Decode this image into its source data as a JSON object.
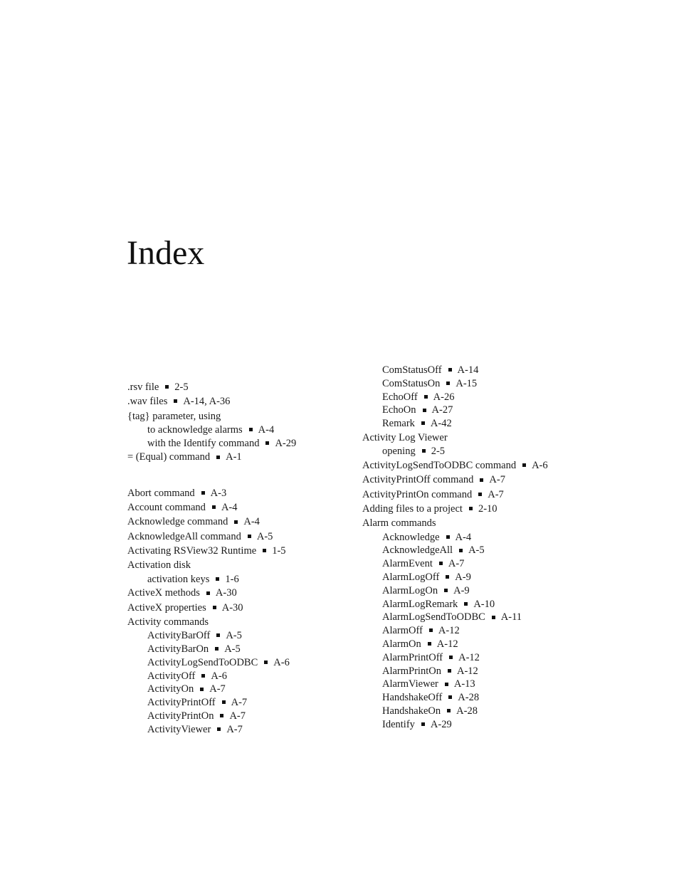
{
  "title": "Index",
  "left_column": [
    {
      "level": 0,
      "term": ".rsv file",
      "pages": "2-5"
    },
    {
      "level": 0,
      "term": ".wav files",
      "pages": "A-14, A-36"
    },
    {
      "level": 0,
      "term": "{tag} parameter, using",
      "pages": ""
    },
    {
      "level": 1,
      "term": "to acknowledge alarms",
      "pages": "A-4"
    },
    {
      "level": 1,
      "term": "with the Identify command",
      "pages": "A-29"
    },
    {
      "level": 0,
      "term": "= (Equal) command",
      "pages": "A-1"
    },
    {
      "level": "gap"
    },
    {
      "level": 0,
      "term": "Abort command",
      "pages": "A-3"
    },
    {
      "level": 0,
      "term": "Account command",
      "pages": "A-4"
    },
    {
      "level": 0,
      "term": "Acknowledge command",
      "pages": "A-4"
    },
    {
      "level": 0,
      "term": "AcknowledgeAll command",
      "pages": "A-5"
    },
    {
      "level": 0,
      "term": "Activating RSView32 Runtime",
      "pages": "1-5"
    },
    {
      "level": 0,
      "term": "Activation disk",
      "pages": ""
    },
    {
      "level": 1,
      "term": "activation keys",
      "pages": "1-6"
    },
    {
      "level": 0,
      "term": "ActiveX methods",
      "pages": "A-30"
    },
    {
      "level": 0,
      "term": "ActiveX properties",
      "pages": "A-30"
    },
    {
      "level": 0,
      "term": "Activity commands",
      "pages": ""
    },
    {
      "level": 1,
      "term": "ActivityBarOff",
      "pages": "A-5"
    },
    {
      "level": 1,
      "term": "ActivityBarOn",
      "pages": "A-5"
    },
    {
      "level": 1,
      "term": "ActivityLogSendToODBC",
      "pages": "A-6"
    },
    {
      "level": 1,
      "term": "ActivityOff",
      "pages": "A-6"
    },
    {
      "level": 1,
      "term": "ActivityOn",
      "pages": "A-7"
    },
    {
      "level": 1,
      "term": "ActivityPrintOff",
      "pages": "A-7"
    },
    {
      "level": 1,
      "term": "ActivityPrintOn",
      "pages": "A-7"
    },
    {
      "level": 1,
      "term": "ActivityViewer",
      "pages": "A-7"
    }
  ],
  "right_column": [
    {
      "level": 1,
      "term": "ComStatusOff",
      "pages": "A-14"
    },
    {
      "level": 1,
      "term": "ComStatusOn",
      "pages": "A-15"
    },
    {
      "level": 1,
      "term": "EchoOff",
      "pages": "A-26"
    },
    {
      "level": 1,
      "term": "EchoOn",
      "pages": "A-27"
    },
    {
      "level": 1,
      "term": "Remark",
      "pages": "A-42"
    },
    {
      "level": 0,
      "term": "Activity Log Viewer",
      "pages": ""
    },
    {
      "level": 1,
      "term": "opening",
      "pages": "2-5"
    },
    {
      "level": 0,
      "term": "ActivityLogSendToODBC command",
      "pages": "A-6"
    },
    {
      "level": 0,
      "term": "ActivityPrintOff command",
      "pages": "A-7"
    },
    {
      "level": 0,
      "term": "ActivityPrintOn command",
      "pages": "A-7"
    },
    {
      "level": 0,
      "term": "Adding files to a project",
      "pages": "2-10"
    },
    {
      "level": 0,
      "term": "Alarm commands",
      "pages": ""
    },
    {
      "level": 1,
      "term": "Acknowledge",
      "pages": "A-4"
    },
    {
      "level": 1,
      "term": "AcknowledgeAll",
      "pages": "A-5"
    },
    {
      "level": 1,
      "term": "AlarmEvent",
      "pages": "A-7"
    },
    {
      "level": 1,
      "term": "AlarmLogOff",
      "pages": "A-9"
    },
    {
      "level": 1,
      "term": "AlarmLogOn",
      "pages": "A-9"
    },
    {
      "level": 1,
      "term": "AlarmLogRemark",
      "pages": "A-10"
    },
    {
      "level": 1,
      "term": "AlarmLogSendToODBC",
      "pages": "A-11"
    },
    {
      "level": 1,
      "term": "AlarmOff",
      "pages": "A-12"
    },
    {
      "level": 1,
      "term": "AlarmOn",
      "pages": "A-12"
    },
    {
      "level": 1,
      "term": "AlarmPrintOff",
      "pages": "A-12"
    },
    {
      "level": 1,
      "term": "AlarmPrintOn",
      "pages": "A-12"
    },
    {
      "level": 1,
      "term": "AlarmViewer",
      "pages": "A-13"
    },
    {
      "level": 1,
      "term": "HandshakeOff",
      "pages": "A-28"
    },
    {
      "level": 1,
      "term": "HandshakeOn",
      "pages": "A-28"
    },
    {
      "level": 1,
      "term": "Identify",
      "pages": "A-29"
    }
  ]
}
